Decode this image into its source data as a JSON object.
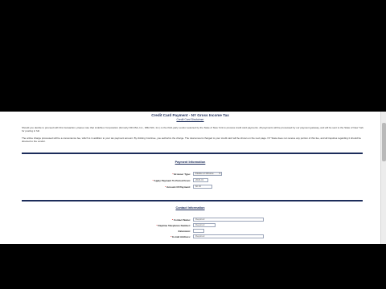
{
  "page": {
    "title": "Credit Card Payment - NY Gross Income Tax",
    "subtitle": "Credit Card Disclaimer"
  },
  "intro": {
    "paragraph_1": "Should you decide to proceed with this transaction, please note that Link2Gov Corporation (formerly NICUSA, Inc., DBA NIC, Inc.) is the third-party vendor selected by the State of New York to process credit card payments. All payments will be processed by our payment gateway, and will be sent to the State of New York for posting in full.",
    "paragraph_2": "The online charge processed will be a convenience fee, which is in addition to your tax payment amount. By clicking Continue, you authorize the charge. The total amount charged to your credit card will be shown on the next page. NY State does not receive any portion of this fee, and all inquiries regarding it should be directed to the vendor."
  },
  "payment_section": {
    "heading": "Payment Information",
    "fields": [
      {
        "label": "Browser Type:",
        "value": "Firefox or Chrome"
      },
      {
        "label": "Apply Payment To Period From:",
        "value": "2023-01"
      },
      {
        "label": "Amount Of Payment:",
        "value": "$0.00"
      }
    ]
  },
  "contact_section": {
    "heading": "Contact Information",
    "fields": [
      {
        "label": "Contact Name:",
        "placeholder": "Required"
      },
      {
        "label": "Daytime Telephone Number:",
        "placeholder": "Required"
      },
      {
        "label": "Extension:",
        "placeholder": ""
      },
      {
        "label": "E-mail Address:",
        "placeholder": "Required"
      }
    ]
  },
  "colors": {
    "heading_navy": "#1c2c5a",
    "required_red": "#cc0000",
    "letterbox_black": "#000000"
  }
}
